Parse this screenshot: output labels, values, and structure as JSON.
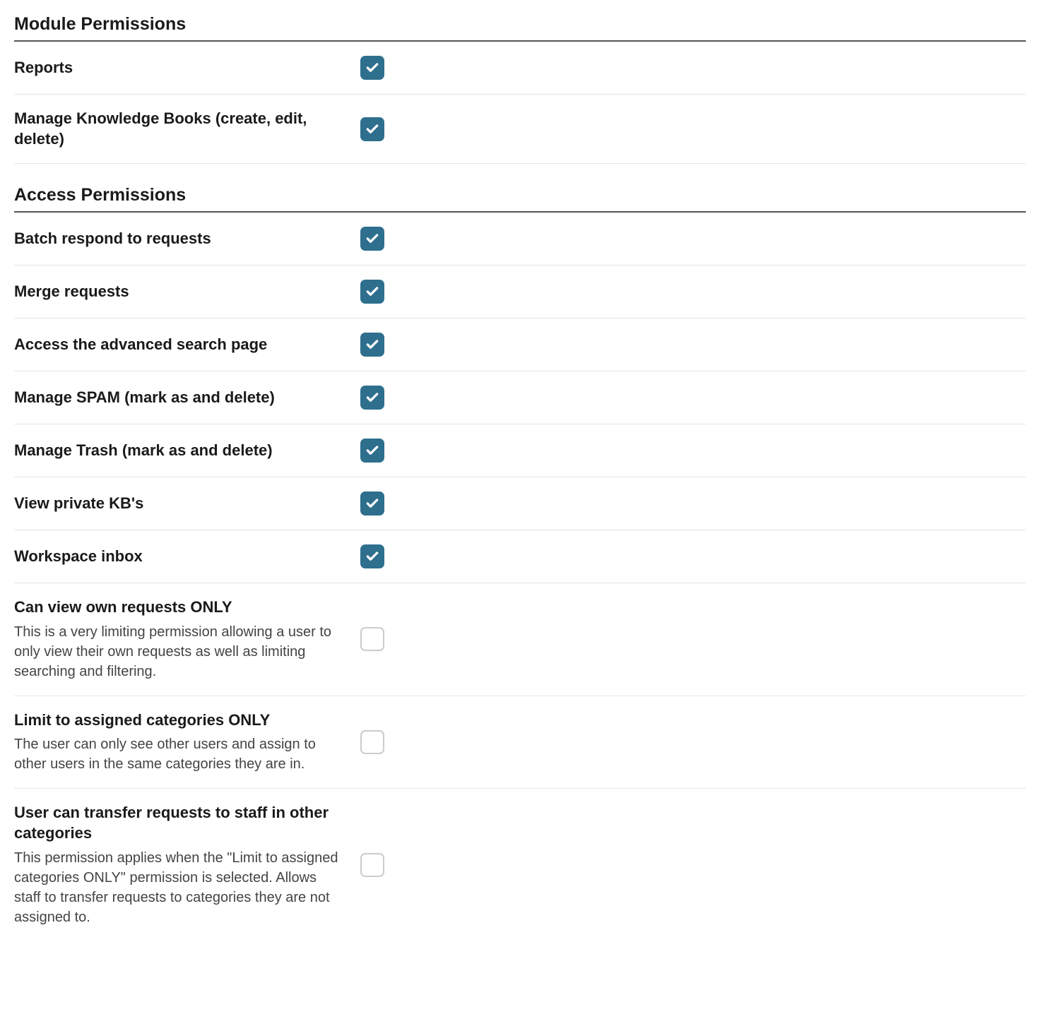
{
  "sections": [
    {
      "title": "Module Permissions",
      "items": [
        {
          "label": "Reports",
          "desc": "",
          "checked": true
        },
        {
          "label": "Manage Knowledge Books (create, edit, delete)",
          "desc": "",
          "checked": true
        }
      ]
    },
    {
      "title": "Access Permissions",
      "items": [
        {
          "label": "Batch respond to requests",
          "desc": "",
          "checked": true
        },
        {
          "label": "Merge requests",
          "desc": "",
          "checked": true
        },
        {
          "label": "Access the advanced search page",
          "desc": "",
          "checked": true
        },
        {
          "label": "Manage SPAM (mark as and delete)",
          "desc": "",
          "checked": true
        },
        {
          "label": "Manage Trash (mark as and delete)",
          "desc": "",
          "checked": true
        },
        {
          "label": "View private KB's",
          "desc": "",
          "checked": true
        },
        {
          "label": "Workspace inbox",
          "desc": "",
          "checked": true
        },
        {
          "label": "Can view own requests ONLY",
          "desc": "This is a very limiting permission allowing a user to only view their own requests as well as limiting searching and filtering.",
          "checked": false
        },
        {
          "label": "Limit to assigned categories ONLY",
          "desc": "The user can only see other users and assign to other users in the same categories they are in.",
          "checked": false
        },
        {
          "label": "User can transfer requests to staff in other categories",
          "desc": "This permission applies when the \"Limit to assigned categories ONLY\" permission is selected. Allows staff to transfer requests to categories they are not assigned to.",
          "checked": false
        }
      ]
    }
  ]
}
